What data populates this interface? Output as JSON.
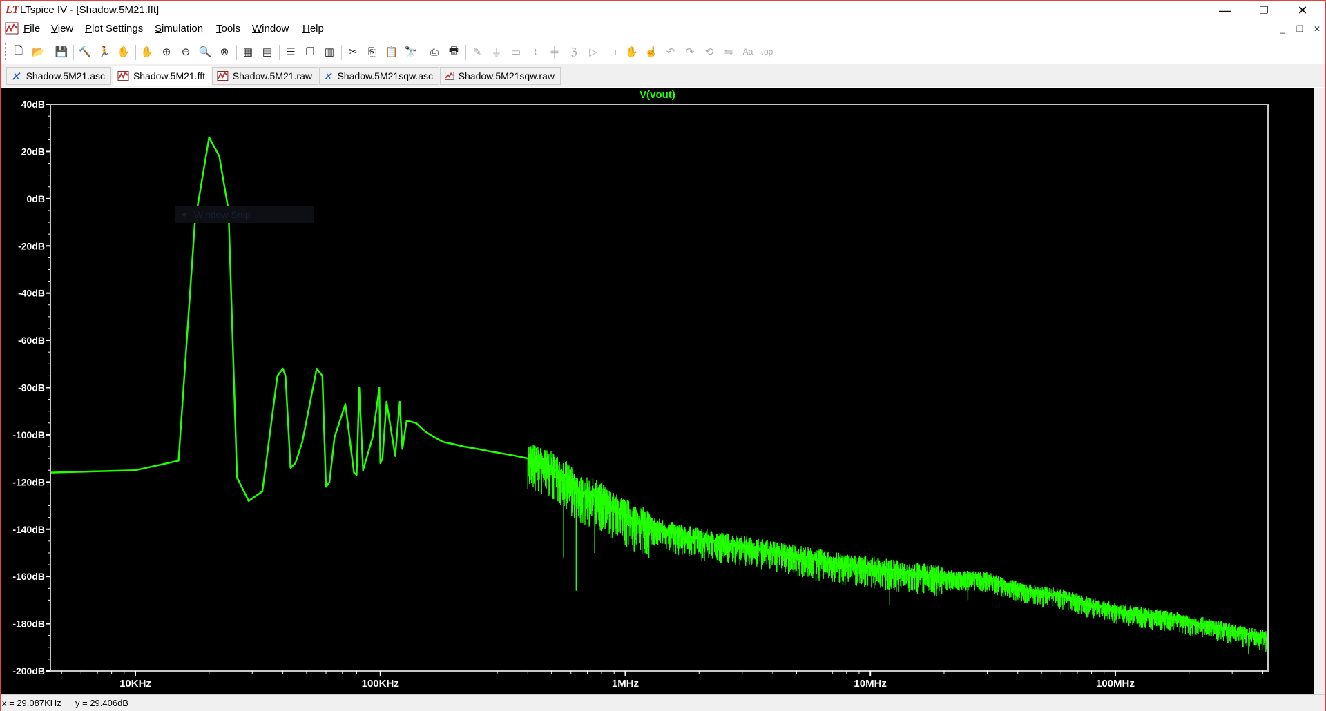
{
  "window": {
    "app_icon": "LT",
    "title": "LTspice IV - [Shadow.5M21.fft]",
    "minimize_icon": "minimize-icon",
    "restore_icon": "restore-icon",
    "close_icon": "close-icon"
  },
  "menu": {
    "items": [
      "File",
      "View",
      "Plot Settings",
      "Simulation",
      "Tools",
      "Window",
      "Help"
    ],
    "mnemonics": [
      "F",
      "V",
      "P",
      "S",
      "T",
      "W",
      "H"
    ]
  },
  "toolbar": {
    "icons": [
      "new-schematic-icon",
      "open-icon",
      "save-icon",
      "control-panel-icon",
      "run-icon",
      "halt-icon",
      "pan-icon",
      "zoom-in-icon",
      "zoom-out-icon",
      "zoom-full-icon",
      "zoom-cancel-icon",
      "autorange-icon",
      "mark-data-points-icon",
      "tile-horizontal-icon",
      "cascade-icon",
      "tile-vertical-icon",
      "cut-icon",
      "copy-icon",
      "paste-icon",
      "find-icon",
      "print-setup-icon",
      "print-icon",
      "draw-wire-icon",
      "ground-icon",
      "label-net-icon",
      "resistor-icon",
      "capacitor-icon",
      "inductor-icon",
      "diode-icon",
      "component-icon",
      "move-icon",
      "drag-icon",
      "undo-icon",
      "redo-icon",
      "rotate-icon",
      "mirror-icon",
      "text-icon",
      "spice-directive-icon"
    ]
  },
  "tabs": [
    {
      "label": "Shadow.5M21.asc",
      "icon": "schematic-icon",
      "active": false
    },
    {
      "label": "Shadow.5M21.fft",
      "icon": "waveform-icon",
      "active": true
    },
    {
      "label": "Shadow.5M21.raw",
      "icon": "waveform-icon",
      "active": false
    },
    {
      "label": "Shadow.5M21sqw.asc",
      "icon": "schematic-icon",
      "active": false
    },
    {
      "label": "Shadow.5M21sqw.raw",
      "icon": "waveform-icon",
      "active": false
    }
  ],
  "watermark": "Window Snip",
  "chart_data": {
    "type": "line",
    "title": "V(vout)",
    "xlabel": "",
    "ylabel": "",
    "xscale": "log",
    "xlim_hz": [
      4500,
      420000000
    ],
    "ylim_db": [
      -200,
      40
    ],
    "xticks": [
      "10KHz",
      "100KHz",
      "1MHz",
      "10MHz",
      "100MHz"
    ],
    "yticks": [
      "40dB",
      "20dB",
      "0dB",
      "-20dB",
      "-40dB",
      "-60dB",
      "-80dB",
      "-100dB",
      "-120dB",
      "-140dB",
      "-160dB",
      "-180dB",
      "-200dB"
    ],
    "grid": false,
    "colors": {
      "background": "#000000",
      "trace": "#21ff00",
      "axes": "#ffffff",
      "title": "#21ff00"
    },
    "series": [
      {
        "name": "V(vout)",
        "x_hz": [
          4500,
          10000,
          15000,
          17500,
          20000,
          22000,
          24000,
          26000,
          29000,
          33000,
          38000,
          40000,
          41000,
          43000,
          45000,
          48000,
          55000,
          58000,
          60000,
          62000,
          65000,
          72000,
          78000,
          80000,
          82000,
          85000,
          93000,
          99000,
          100000,
          102000,
          106000,
          115000,
          120000,
          123000,
          128000,
          140000,
          150000,
          160000,
          180000,
          200000,
          220000,
          250000,
          280000,
          320000,
          360000,
          400000,
          450000,
          500000,
          560000,
          600000,
          640000,
          700000,
          780000,
          850000,
          1000000,
          1200000,
          1500000,
          2000000,
          3000000,
          5000000,
          7000000,
          10000000,
          14000000,
          20000000,
          30000000,
          40000000,
          50000000,
          60000000,
          70000000,
          80000000,
          100000000,
          130000000,
          180000000,
          250000000,
          330000000,
          420000000
        ],
        "y_db": [
          -116,
          -115,
          -111,
          -10,
          26,
          18,
          -5,
          -118,
          -128,
          -124,
          -75,
          -72,
          -75,
          -114,
          -112,
          -103,
          -72,
          -75,
          -122,
          -120,
          -101,
          -87,
          -116,
          -117,
          -80,
          -115,
          -101,
          -80,
          -112,
          -110,
          -86,
          -109,
          -86,
          -106,
          -94,
          -95,
          -98,
          -100,
          -103,
          -104,
          -105,
          -106,
          -107,
          -108,
          -109,
          -110,
          -112,
          -114,
          -117,
          -120,
          -124,
          -125,
          -126,
          -130,
          -134,
          -138,
          -141,
          -144,
          -147,
          -151,
          -154,
          -156,
          -158,
          -160,
          -161,
          -165,
          -167,
          -168,
          -170,
          -172,
          -174,
          -176,
          -178,
          -181,
          -184,
          -186
        ]
      }
    ],
    "dense_noise_band": {
      "x_from_hz": 400000,
      "x_to_hz": 420000000,
      "dips_db_at_hz": [
        [
          630000,
          -166
        ],
        [
          560000,
          -152
        ],
        [
          750000,
          -150
        ],
        [
          2800000,
          -154
        ],
        [
          6000000,
          -162
        ],
        [
          12000000,
          -172
        ],
        [
          25000000,
          -170
        ],
        [
          45000000,
          -166
        ],
        [
          100000000,
          -176
        ],
        [
          200000000,
          -183
        ],
        [
          350000000,
          -193
        ]
      ]
    }
  },
  "status": {
    "x": "x = 29.087KHz",
    "y": "y = 29.406dB"
  }
}
